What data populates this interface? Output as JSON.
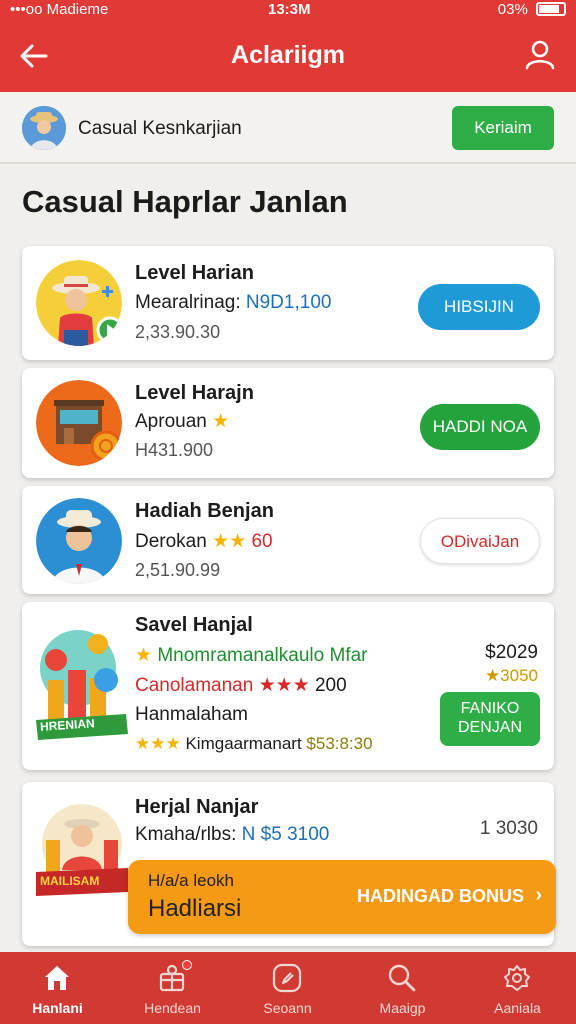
{
  "status": {
    "carrier": "•••oo Madieme",
    "time": "13:3M",
    "battery": "03%"
  },
  "header": {
    "title": "Aclariigm"
  },
  "profile": {
    "name": "Casual Kesnkarjian",
    "button": "Keriaim"
  },
  "section_title": "Casual Haprlar Janlan",
  "cards": [
    {
      "title": "Level Harian",
      "line2_label": "Mearalrinag:",
      "line2_value": "N9D1,100",
      "line3": "2,33.90.30",
      "cta": "HIBSIJIN",
      "cta_color": "#1e9ad6"
    },
    {
      "title": "Level Harajn",
      "line2_label": "Aprouan",
      "line2_stars": "★",
      "line3": "H431.900",
      "cta": "HADDI NOA",
      "cta_color": "#24a23c"
    },
    {
      "title": "Hadiah Benjan",
      "line2_label": "Derokan",
      "line2_stars": "★★",
      "line2_value": "60",
      "line3": "2,51.90.99",
      "cta": "ODivaiJan",
      "cta_color": "#ffffff"
    },
    {
      "title": "Savel Hanjal",
      "line2": "Mnomramanalkaulo Mfar",
      "line3_label": "Canolamanan",
      "line3_stars": "★★★",
      "line3_value": "200",
      "line4": "Hanmalaham",
      "line5_stars": "★★★",
      "line5_label": "Kimgaarmanart",
      "line5_value": "$53:8:30",
      "price": "$2029",
      "price2": "★3050",
      "cta_line1": "FANIKO",
      "cta_line2": "DENJAN",
      "cta_color": "#2fae48",
      "thumb_text": "HRENIAN"
    },
    {
      "title": "Herjal Nanjar",
      "line2_label": "Kmaha/rlbs:",
      "line2_value": "N $5 3100",
      "price": "1 3030",
      "thumb_text": "MAILISAM"
    }
  ],
  "bonus": {
    "small": "H/a/a leokh",
    "big": "Hadliarsi",
    "label": "HADINGAD BONUS"
  },
  "tabs": [
    {
      "label": "Hanlani",
      "icon": "home-icon",
      "active": true
    },
    {
      "label": "Hendean",
      "icon": "gift-icon",
      "active": false
    },
    {
      "label": "Seoann",
      "icon": "compass-icon",
      "active": false
    },
    {
      "label": "Maaigp",
      "icon": "search-icon",
      "active": false
    },
    {
      "label": "Aaniala",
      "icon": "settings-icon",
      "active": false
    }
  ],
  "colors": {
    "primary": "#e13a36",
    "tabbar": "#d03a33",
    "green": "#2fae48",
    "blue": "#1e9ad6",
    "orange": "#f69a14"
  }
}
